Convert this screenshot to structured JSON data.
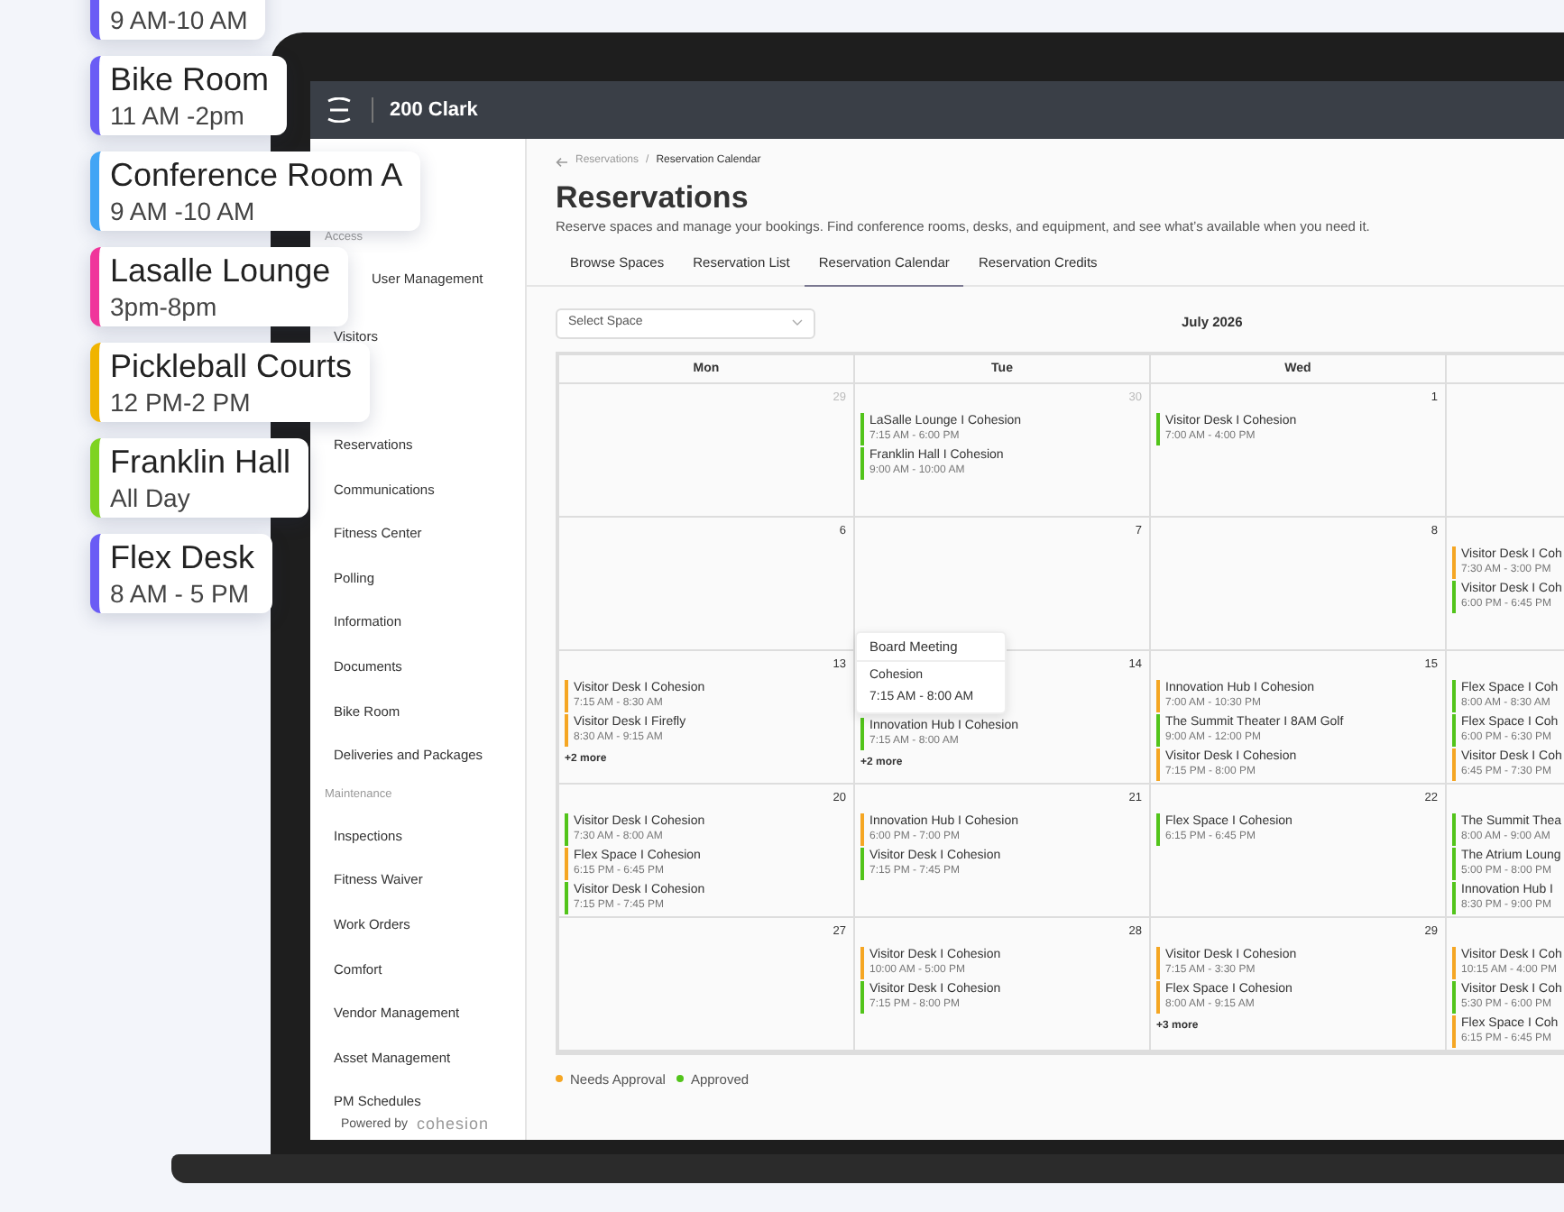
{
  "header": {
    "building": "200 Clark"
  },
  "sidebar": {
    "items": [
      {
        "kind": "section",
        "label": "Access"
      },
      {
        "kind": "item",
        "label": "User Management"
      },
      {
        "kind": "item",
        "label": "Visitors"
      },
      {
        "kind": "item",
        "label": "Reservations"
      },
      {
        "kind": "item",
        "label": "Communications"
      },
      {
        "kind": "item",
        "label": "Fitness Center"
      },
      {
        "kind": "item",
        "label": "Polling"
      },
      {
        "kind": "item",
        "label": "Information"
      },
      {
        "kind": "item",
        "label": "Documents"
      },
      {
        "kind": "item",
        "label": "Bike Room"
      },
      {
        "kind": "item",
        "label": "Deliveries and Packages"
      },
      {
        "kind": "section",
        "label": "Maintenance"
      },
      {
        "kind": "item",
        "label": "Inspections"
      },
      {
        "kind": "item",
        "label": "Fitness Waiver"
      },
      {
        "kind": "item",
        "label": "Work Orders"
      },
      {
        "kind": "item",
        "label": "Comfort"
      },
      {
        "kind": "item",
        "label": "Vendor Management"
      },
      {
        "kind": "item",
        "label": "Asset Management"
      },
      {
        "kind": "item",
        "label": "PM Schedules"
      }
    ],
    "footer": {
      "label": "Powered by",
      "brand": "cohesion"
    }
  },
  "breadcrumb": {
    "parent": "Reservations",
    "separator": "/",
    "current": "Reservation Calendar"
  },
  "title": "Reservations",
  "description": "Reserve spaces and manage your bookings. Find conference rooms, desks, and equipment, and see what’s available when you need it.",
  "tabs": [
    {
      "label": "Browse Spaces",
      "selected": false
    },
    {
      "label": "Reservation List",
      "selected": false
    },
    {
      "label": "Reservation Calendar",
      "selected": true
    },
    {
      "label": "Reservation Credits",
      "selected": false
    }
  ],
  "space_select": {
    "placeholder": "Select Space"
  },
  "calendar": {
    "month": "July 2026",
    "weekdays": [
      "Mon",
      "Tue",
      "Wed"
    ],
    "weeks": [
      {
        "days": [
          {
            "day": "29",
            "muted": true
          },
          {
            "day": "30",
            "muted": true,
            "events": [
              {
                "title": "LaSalle Lounge I Cohesion",
                "time": "7:15 AM - 6:00 PM",
                "approved": true
              },
              {
                "title": "Franklin Hall I Cohesion",
                "time": "9:00 AM - 10:00 AM",
                "approved": true
              }
            ]
          },
          {
            "day": "1",
            "muted": false,
            "events": [
              {
                "title": "Visitor Desk I Cohesion",
                "time": "7:00 AM - 4:00 PM",
                "approved": true
              }
            ]
          }
        ]
      },
      {
        "days": [
          {
            "day": "6",
            "muted": false
          },
          {
            "day": "7",
            "muted": false
          },
          {
            "day": "8",
            "muted": false
          },
          {
            "events": [
              {
                "title": "Visitor Desk I Coh",
                "time": "7:30 AM - 3:00 PM",
                "approved": false
              },
              {
                "title": "Visitor Desk I Coh",
                "time": "6:00 PM - 6:45 PM",
                "approved": true
              }
            ]
          }
        ]
      },
      {
        "days": [
          {
            "day": "13",
            "muted": false,
            "events": [
              {
                "title": "Visitor Desk I Cohesion",
                "time": "7:15 AM - 8:30 AM",
                "approved": false
              },
              {
                "title": "Visitor Desk I Firefly",
                "time": "8:30 AM - 9:15 AM",
                "approved": false
              }
            ],
            "more": "+2 more"
          },
          {
            "day": "14",
            "muted": false,
            "popover": {
              "title": "Board Meeting",
              "place": "Cohesion",
              "time": "7:15 AM - 8:00 AM"
            },
            "events": [
              {
                "title": "Innovation Hub I Cohesion",
                "time": "7:15 AM - 8:00 AM",
                "approved": true
              }
            ],
            "more": "+2 more"
          },
          {
            "day": "15",
            "muted": false,
            "events": [
              {
                "title": "Innovation Hub I Cohesion",
                "time": "7:00 AM - 10:30 PM",
                "approved": false
              },
              {
                "title": "The Summit Theater I 8AM Golf",
                "time": "9:00 AM - 12:00 PM",
                "approved": true
              },
              {
                "title": "Visitor Desk I Cohesion",
                "time": "7:15 PM - 8:00 PM",
                "approved": false
              }
            ]
          },
          {
            "events": [
              {
                "title": "Flex Space I Coh",
                "time": "8:00 AM - 8:30 AM",
                "approved": true
              },
              {
                "title": "Flex Space I Coh",
                "time": "6:00 PM - 6:30 PM",
                "approved": true
              },
              {
                "title": "Visitor Desk I Coh",
                "time": "6:45 PM - 7:30 PM",
                "approved": false
              }
            ]
          }
        ]
      },
      {
        "days": [
          {
            "day": "20",
            "muted": false,
            "events": [
              {
                "title": "Visitor Desk I Cohesion",
                "time": "7:30 AM - 8:00 AM",
                "approved": true
              },
              {
                "title": "Flex Space I Cohesion",
                "time": "6:15 PM - 6:45 PM",
                "approved": false
              },
              {
                "title": "Visitor Desk I Cohesion",
                "time": "7:15 PM - 7:45 PM",
                "approved": true
              }
            ]
          },
          {
            "day": "21",
            "muted": false,
            "events": [
              {
                "title": "Innovation Hub I Cohesion",
                "time": "6:00 PM - 7:00 PM",
                "approved": false
              },
              {
                "title": "Visitor Desk I Cohesion",
                "time": "7:15 PM - 7:45 PM",
                "approved": true
              }
            ]
          },
          {
            "day": "22",
            "muted": false,
            "events": [
              {
                "title": "Flex Space I Cohesion",
                "time": "6:15 PM - 6:45 PM",
                "approved": true
              }
            ]
          },
          {
            "events": [
              {
                "title": "The Summit Thea",
                "time": "8:00 AM - 9:00 AM",
                "approved": true
              },
              {
                "title": "The Atrium Loung",
                "time": "5:00 PM - 8:00 PM",
                "approved": true
              },
              {
                "title": "Innovation Hub I",
                "time": "8:30 PM - 9:00 PM",
                "approved": true
              }
            ]
          }
        ]
      },
      {
        "days": [
          {
            "day": "27",
            "muted": false
          },
          {
            "day": "28",
            "muted": false,
            "events": [
              {
                "title": "Visitor Desk I Cohesion",
                "time": "10:00 AM - 5:00 PM",
                "approved": false
              },
              {
                "title": "Visitor Desk I Cohesion",
                "time": "7:15 PM - 8:00 PM",
                "approved": true
              }
            ]
          },
          {
            "day": "29",
            "muted": false,
            "events": [
              {
                "title": "Visitor Desk I Cohesion",
                "time": "7:15 AM - 3:30 PM",
                "approved": false
              },
              {
                "title": "Flex Space I Cohesion",
                "time": "8:00 AM - 9:15 AM",
                "approved": false
              }
            ],
            "more": "+3 more"
          },
          {
            "events": [
              {
                "title": "Visitor Desk I Coh",
                "time": "10:15 AM - 4:00 PM",
                "approved": false
              },
              {
                "title": "Visitor Desk I Coh",
                "time": "5:30 PM - 6:00 PM",
                "approved": true
              },
              {
                "title": "Flex Space I Coh",
                "time": "6:15 PM - 6:45 PM",
                "approved": false
              }
            ]
          }
        ]
      }
    ]
  },
  "legend": [
    {
      "label": "Needs Approval",
      "color": "#f5a623"
    },
    {
      "label": "Approved",
      "color": "#52c41a"
    }
  ],
  "booking_cards": [
    {
      "time": "9 AM-10 AM",
      "color": "#6a5cf5"
    },
    {
      "title": "Bike Room",
      "time": "11 AM -2pm",
      "color": "#6a5cf5"
    },
    {
      "title": "Conference Room A",
      "time": "9 AM -10 AM",
      "color": "#42a5f5"
    },
    {
      "title": "Lasalle Lounge",
      "time": "3pm-8pm",
      "color": "#f0359b"
    },
    {
      "title": "Pickleball Courts",
      "time": "12 PM-2 PM",
      "color": "#f0b400"
    },
    {
      "title": "Franklin Hall",
      "time": "All Day",
      "color": "#7ed321"
    },
    {
      "title": "Flex Desk",
      "time": "8 AM - 5 PM",
      "color": "#6a5cf5"
    }
  ]
}
